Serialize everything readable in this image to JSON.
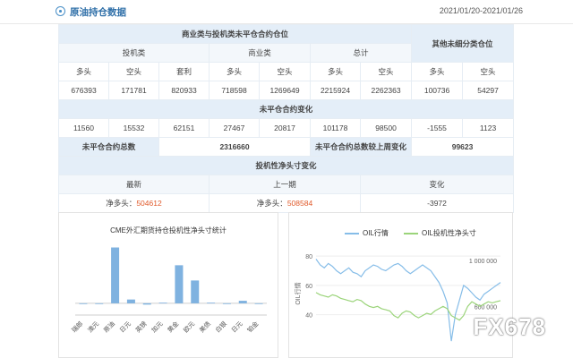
{
  "header": {
    "title": "原油持仓数据",
    "date_range": "2021/01/20-2021/01/26"
  },
  "table": {
    "sec1_title": "商业类与投机类未平仓合约仓位",
    "other_title": "其他未细分类仓位",
    "groups": [
      "投机类",
      "商业类",
      "总计"
    ],
    "cols": [
      "多头",
      "空头",
      "套利",
      "多头",
      "空头",
      "多头",
      "空头",
      "多头",
      "空头"
    ],
    "row1": [
      "676393",
      "171781",
      "820933",
      "718598",
      "1269649",
      "2215924",
      "2262363",
      "100736",
      "54297"
    ],
    "sec2_title": "未平仓合约变化",
    "row2": [
      "11560",
      "15532",
      "62151",
      "27467",
      "20817",
      "101178",
      "98500",
      "-1555",
      "1123"
    ],
    "total_label": "未平仓合约总数",
    "total_value": "2316660",
    "change_label": "未平仓合约总数较上周变化",
    "change_value": "99623",
    "sec3_title": "投机性净头寸变化",
    "latest_label": "最新",
    "prev_label": "上一期",
    "diff_label": "变化",
    "net_label": "净多头：",
    "latest_value": "504612",
    "prev_value": "508584",
    "diff_value": "-3972"
  },
  "bar_chart": {
    "title": "CME外汇期货持仓投机性净头寸统计",
    "color": "#7fb2e0"
  },
  "line_chart": {
    "legend": [
      "OIL行情",
      "OIL投机性净头寸"
    ],
    "colors": [
      "#86bde8",
      "#9bd47a"
    ],
    "left_ticks": [
      "80",
      "60",
      "40"
    ],
    "right_ticks": [
      "1 000 000",
      "600 000"
    ],
    "ylabel": "OIL行情"
  },
  "chart_data": [
    {
      "type": "bar",
      "title": "CME外汇期货持仓投机性净头寸统计",
      "categories": [
        "瑞郎",
        "澳元",
        "原油",
        "日元",
        "英镑",
        "加元",
        "黄金",
        "欧元",
        "美债",
        "白银",
        "日元",
        "铂金"
      ],
      "values": [
        0,
        0,
        88,
        6,
        -2,
        1,
        60,
        36,
        1,
        0,
        4,
        0
      ],
      "ylim": [
        -10,
        100
      ]
    },
    {
      "type": "line",
      "series": [
        {
          "name": "OIL行情",
          "values": [
            78,
            74,
            72,
            75,
            73,
            70,
            68,
            70,
            72,
            69,
            68,
            66,
            70,
            72,
            74,
            73,
            71,
            70,
            72,
            74,
            75,
            73,
            70,
            68,
            70,
            72,
            74,
            72,
            70,
            66,
            62,
            56,
            48,
            22,
            40,
            50,
            60,
            58,
            55,
            52,
            50,
            54,
            56,
            58,
            60,
            62
          ]
        },
        {
          "name": "OIL投机性净头寸",
          "values": [
            720,
            700,
            690,
            680,
            700,
            690,
            670,
            660,
            650,
            640,
            660,
            650,
            620,
            600,
            590,
            600,
            580,
            570,
            560,
            520,
            500,
            540,
            560,
            550,
            520,
            500,
            520,
            540,
            530,
            560,
            580,
            600,
            580,
            520,
            500,
            480,
            520,
            600,
            640,
            620,
            600,
            620,
            640,
            630,
            640,
            650
          ]
        }
      ],
      "ylim_left": [
        30,
        85
      ],
      "ylim_right": [
        400000,
        1100000
      ]
    }
  ]
}
